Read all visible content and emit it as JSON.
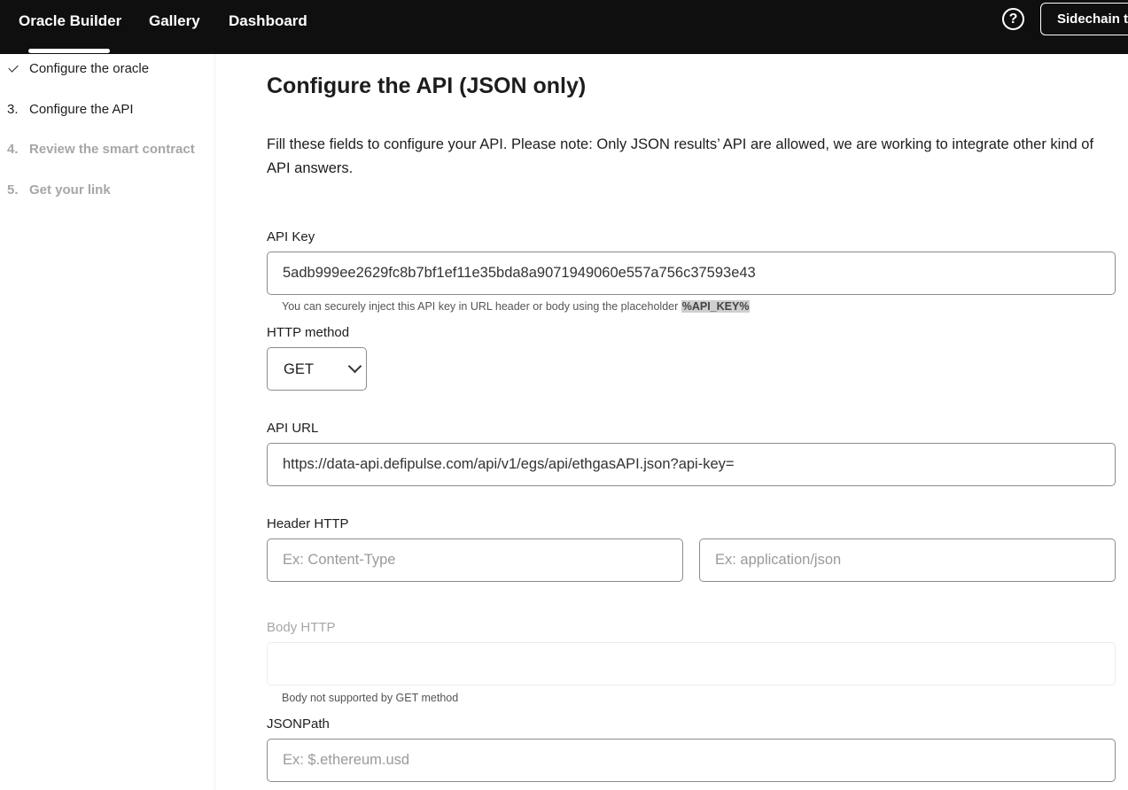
{
  "nav": {
    "links": [
      "Oracle Builder",
      "Gallery",
      "Dashboard"
    ],
    "help_icon": "question-circle-icon",
    "chain_button": "Sidechain te"
  },
  "sidebar": {
    "steps": [
      {
        "num": "",
        "label": "Configure the oracle",
        "state": "done",
        "icon": "check-icon"
      },
      {
        "num": "3.",
        "label": "Configure the API",
        "state": "active"
      },
      {
        "num": "4.",
        "label": "Review the smart contract",
        "state": "pending"
      },
      {
        "num": "5.",
        "label": "Get your link",
        "state": "pending"
      }
    ]
  },
  "main": {
    "title": "Configure the API (JSON only)",
    "intro": "Fill these fields to configure your API. Please note: Only JSON results’ API are allowed, we are working to integrate other kind of API answers.",
    "api_key": {
      "label": "API Key",
      "value": "5adb999ee2629fc8b7bf1ef11e35bda8a9071949060e557a756c37593e43",
      "hint_text": "You can securely inject this API key in URL header or body using the placeholder ",
      "hint_code": "%API_KEY%"
    },
    "http_method": {
      "label": "HTTP method",
      "selected": "GET"
    },
    "api_url": {
      "label": "API URL",
      "value": "https://data-api.defipulse.com/api/v1/egs/api/ethgasAPI.json?api-key="
    },
    "header_http": {
      "label": "Header HTTP",
      "key_placeholder": "Ex: Content-Type",
      "value_placeholder": "Ex: application/json"
    },
    "body_http": {
      "label": "Body HTTP",
      "hint": "Body not supported by GET method"
    },
    "jsonpath": {
      "label": "JSONPath",
      "placeholder": "Ex: $.ethereum.usd"
    }
  },
  "colors": {
    "topbar": "#0f0f0f",
    "field_border": "#8c8c8c",
    "disabled_text": "#a6a6a6"
  }
}
